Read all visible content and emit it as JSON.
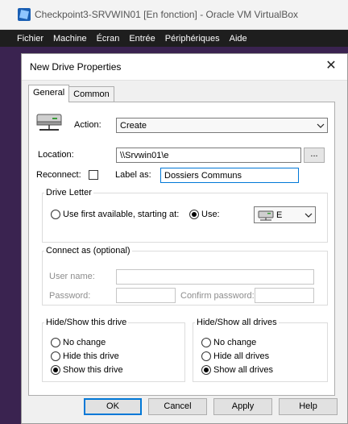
{
  "window": {
    "title": "Checkpoint3-SRVWIN01 [En fonction] - Oracle VM VirtualBox",
    "icon": "virtualbox-icon"
  },
  "menu": [
    "Fichier",
    "Machine",
    "Écran",
    "Entrée",
    "Périphériques",
    "Aide"
  ],
  "dialog": {
    "title": "New Drive Properties",
    "close": "✕",
    "tabs": [
      "General",
      "Common"
    ],
    "action": {
      "label": "Action:",
      "value": "Create"
    },
    "location": {
      "label": "Location:",
      "value": "\\\\Srvwin01\\e",
      "browse": "..."
    },
    "reconnect": {
      "label": "Reconnect:",
      "checked": false
    },
    "label_as": {
      "label": "Label as:",
      "value": "Dossiers Communs"
    },
    "drive_letter": {
      "title": "Drive Letter",
      "option_first": "Use first available, starting at:",
      "option_use": "Use:",
      "selected": "use",
      "letter": "E"
    },
    "connect_as": {
      "title": "Connect as (optional)",
      "user_label": "User name:",
      "password_label": "Password:",
      "confirm_label": "Confirm password:"
    },
    "hide_show_this": {
      "title": "Hide/Show this drive",
      "options": [
        "No change",
        "Hide this drive",
        "Show this drive"
      ],
      "selected": 2
    },
    "hide_show_all": {
      "title": "Hide/Show all drives",
      "options": [
        "No change",
        "Hide all drives",
        "Show all drives"
      ],
      "selected": 2
    },
    "buttons": {
      "ok": "OK",
      "cancel": "Cancel",
      "apply": "Apply",
      "help": "Help"
    }
  }
}
